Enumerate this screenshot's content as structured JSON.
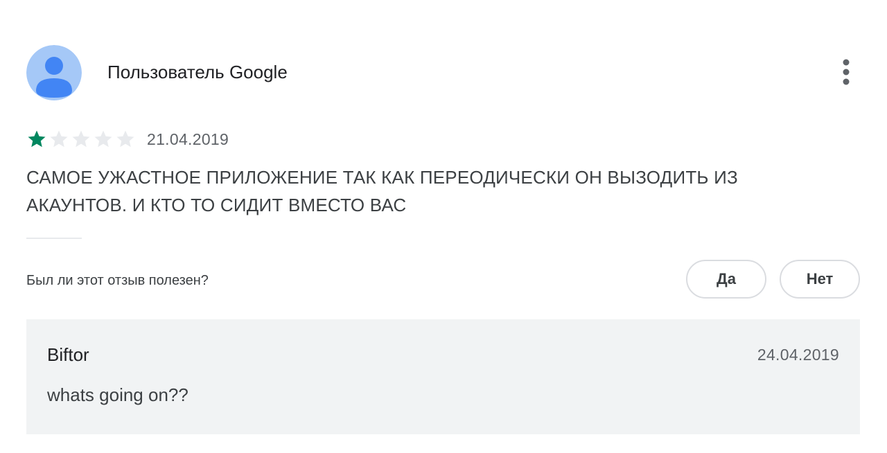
{
  "review": {
    "author": "Пользователь Google",
    "avatar_icon": "default-user-avatar-icon",
    "menu_icon": "more-vert-icon",
    "rating": 1,
    "max_rating": 5,
    "star_filled_color": "#01875f",
    "star_empty_color": "#e8eaed",
    "date": "21.04.2019",
    "text": "САМОЕ УЖАСТНОЕ ПРИЛОЖЕНИЕ ТАК КАК ПЕРЕОДИЧЕСКИ ОН ВЫЗОДИТЬ ИЗ АКАУНТОВ. И КТО ТО СИДИТ ВМЕСТО ВАС"
  },
  "helpful": {
    "question": "Был ли этот отзыв полезен?",
    "yes_label": "Да",
    "no_label": "Нет"
  },
  "reply": {
    "author": "Biftor",
    "date": "24.04.2019",
    "text": "whats going on??"
  },
  "colors": {
    "avatar_background": "#a5c8f7",
    "avatar_figure": "#4285f4",
    "reply_background": "#f1f3f4",
    "button_border": "#dadce0"
  }
}
